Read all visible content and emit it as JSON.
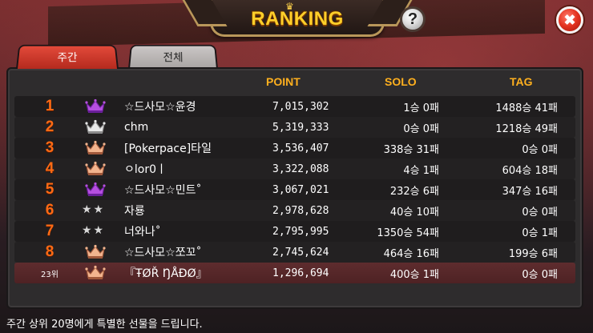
{
  "header": {
    "title": "RANKING",
    "help_label": "?",
    "close_label": "✖"
  },
  "tabs": [
    {
      "label": "주간",
      "active": true
    },
    {
      "label": "전체",
      "active": false
    }
  ],
  "columns": {
    "point": "POINT",
    "solo": "SOLO",
    "tag": "TAG"
  },
  "rows": [
    {
      "rank": "1",
      "badge": "crown-purple",
      "name": "☆드사모☆윤경",
      "point": "7,015,302",
      "solo": "1승 0패",
      "tag": "1488승 41패"
    },
    {
      "rank": "2",
      "badge": "crown-silver",
      "name": "chm",
      "point": "5,319,333",
      "solo": "0승 0패",
      "tag": "1218승 49패"
    },
    {
      "rank": "3",
      "badge": "crown-bronze",
      "name": "[Pokerpace]타일",
      "point": "3,536,407",
      "solo": "338승 31패",
      "tag": "0승 0패"
    },
    {
      "rank": "4",
      "badge": "crown-bronze",
      "name": "ㅇlor0ㅣ",
      "point": "3,322,088",
      "solo": "4승 1패",
      "tag": "604승 18패"
    },
    {
      "rank": "5",
      "badge": "crown-purple",
      "name": "☆드사모☆민트˚",
      "point": "3,067,021",
      "solo": "232승 6패",
      "tag": "347승 16패"
    },
    {
      "rank": "6",
      "badge": "stars",
      "name": "자룡",
      "point": "2,978,628",
      "solo": "40승 10패",
      "tag": "0승 0패"
    },
    {
      "rank": "7",
      "badge": "stars",
      "name": "너와나˚",
      "point": "2,795,995",
      "solo": "1350승 54패",
      "tag": "0승 1패"
    },
    {
      "rank": "8",
      "badge": "crown-bronze",
      "name": "☆드사모☆쪼꼬˚",
      "point": "2,745,624",
      "solo": "464승 16패",
      "tag": "199승 6패"
    }
  ],
  "my_row": {
    "rank": "23위",
    "badge": "crown-bronze",
    "name": "『ŦØŘ ŊÅĐØ』",
    "point": "1,296,694",
    "solo": "400승 1패",
    "tag": "0승 0패"
  },
  "footer_text": "주간 상위 20명에게 특별한 선물을 드립니다.",
  "colors": {
    "accent": "#ffb01e",
    "rank": "#ff6a14",
    "title": "#ffcf2a",
    "tab_active": "#d63a2c"
  }
}
